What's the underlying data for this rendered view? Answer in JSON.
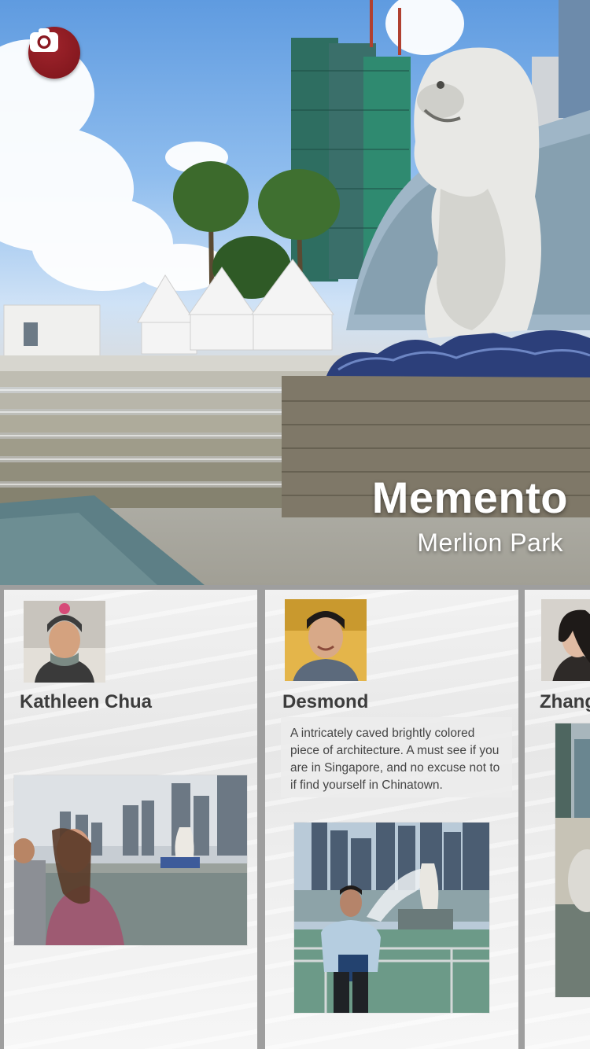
{
  "hero": {
    "title": "Memento",
    "subtitle": "Merlion Park",
    "camera_icon": "camera-icon",
    "accent_color": "#8a1820"
  },
  "cards": [
    {
      "name": "Kathleen Chua",
      "comment": ""
    },
    {
      "name": "Desmond",
      "comment": "A intricately caved brightly colored piece of architecture. A must see if you are in Singapore, and no excuse not to if find yourself in Chinatown."
    },
    {
      "name": "Zhang",
      "comment": ""
    }
  ]
}
